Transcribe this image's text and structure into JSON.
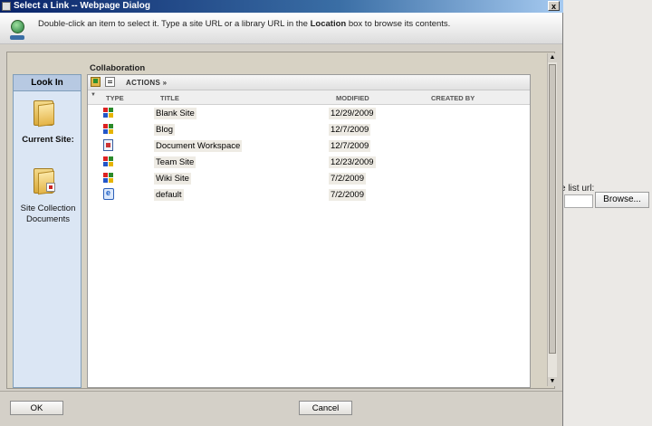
{
  "background": {
    "list_url_label": "e list url:",
    "browse_button": "Browse..."
  },
  "dialog": {
    "title": "Select a Link -- Webpage Dialog",
    "close_glyph": "x",
    "instructions": {
      "part1": "Double-click an item to select it. Type a site URL or a library URL in the ",
      "bold": "Location",
      "part2": " box to browse its contents."
    }
  },
  "lookin": {
    "header": "Look In",
    "items": [
      {
        "label": "Current Site:",
        "icon": "folder-icon"
      },
      {
        "label": "Site Collection Documents",
        "icon": "folder-doc-icon"
      }
    ]
  },
  "list": {
    "location_label": "Collaboration",
    "toolbar": {
      "actions_label": "ACTIONS »"
    },
    "columns": {
      "type": "TYPE",
      "title": "TITLE",
      "modified": "MODIFIED",
      "created_by": "CREATED BY"
    },
    "rows": [
      {
        "icon": "site-icon",
        "title": "Blank Site",
        "modified": "12/29/2009",
        "created_by": ""
      },
      {
        "icon": "site-icon",
        "title": "Blog",
        "modified": "12/7/2009",
        "created_by": ""
      },
      {
        "icon": "document-workspace-icon",
        "title": "Document Workspace",
        "modified": "12/7/2009",
        "created_by": ""
      },
      {
        "icon": "site-icon",
        "title": "Team Site",
        "modified": "12/23/2009",
        "created_by": ""
      },
      {
        "icon": "site-icon",
        "title": "Wiki Site",
        "modified": "7/2/2009",
        "created_by": ""
      },
      {
        "icon": "web-page-icon",
        "title": "default",
        "modified": "7/2/2009",
        "created_by": ""
      }
    ]
  },
  "footer": {
    "ok_label": "OK",
    "cancel_label": "Cancel"
  },
  "colors": {
    "titlebar": "#0a246a",
    "sidebar": "#dbe6f4",
    "dialog_bg": "#d4d0c8"
  }
}
